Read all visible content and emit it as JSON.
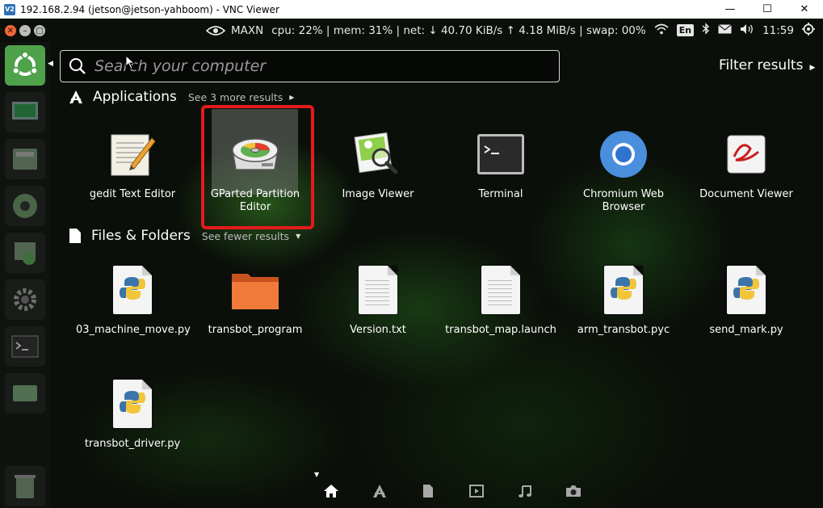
{
  "window": {
    "title": "192.168.2.94 (jetson@jetson-yahboom) - VNC Viewer",
    "app_badge": "V2",
    "minimize": "—",
    "maximize": "☐",
    "close": "✕"
  },
  "panel": {
    "nv_label": "MAXN",
    "stats": "cpu: 22% | mem: 31% | net: ↓ 40.70 KiB/s ↑  4.18 MiB/s | swap: 00%",
    "keyboard": "En",
    "clock": "11:59"
  },
  "search": {
    "placeholder": "Search your computer",
    "filter_label": "Filter results"
  },
  "applications": {
    "title": "Applications",
    "see_more": "See 3 more results",
    "items": [
      {
        "label": "gedit Text Editor",
        "icon": "gedit-icon"
      },
      {
        "label": "GParted Partition Editor",
        "icon": "gparted-icon"
      },
      {
        "label": "Image Viewer",
        "icon": "image-viewer-icon"
      },
      {
        "label": "Terminal",
        "icon": "terminal-icon"
      },
      {
        "label": "Chromium Web Browser",
        "icon": "chromium-icon"
      },
      {
        "label": "Document Viewer",
        "icon": "document-viewer-icon"
      }
    ]
  },
  "files": {
    "title": "Files & Folders",
    "see_fewer": "See fewer results",
    "items": [
      {
        "label": "03_machine_move.py",
        "icon": "python-file-icon"
      },
      {
        "label": "transbot_program",
        "icon": "folder-icon"
      },
      {
        "label": "Version.txt",
        "icon": "text-file-icon"
      },
      {
        "label": "transbot_map.launch",
        "icon": "text-file-icon"
      },
      {
        "label": "arm_transbot.pyc",
        "icon": "python-file-icon"
      },
      {
        "label": "send_mark.py",
        "icon": "python-file-icon"
      },
      {
        "label": "transbot_driver.py",
        "icon": "python-file-icon"
      }
    ]
  },
  "colors": {
    "highlight": "#e41b1b",
    "ubuntu_orange": "#e95420",
    "launcher_bfb": "#4fa14a"
  }
}
